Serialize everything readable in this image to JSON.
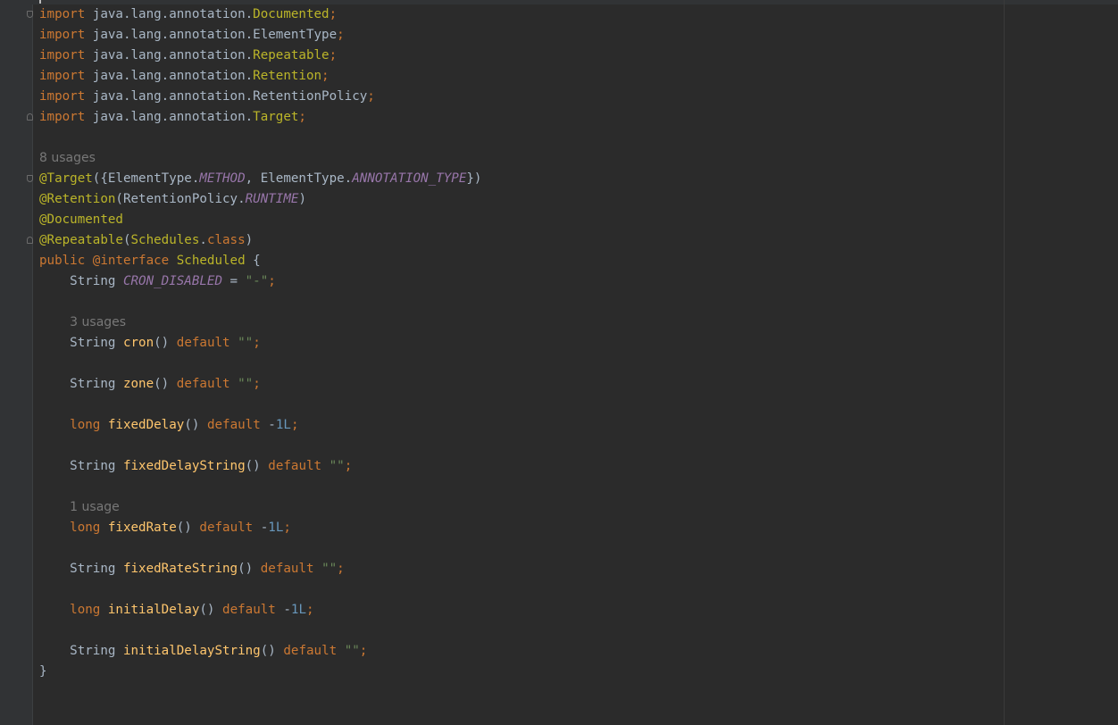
{
  "code": {
    "imports": [
      {
        "kw": "import",
        "pkg": "java.lang.annotation.",
        "cls": "Documented",
        "semi": ";"
      },
      {
        "kw": "import",
        "pkg": "java.lang.annotation.",
        "cls": "ElementType",
        "semi": ";"
      },
      {
        "kw": "import",
        "pkg": "java.lang.annotation.",
        "cls": "Repeatable",
        "semi": ";"
      },
      {
        "kw": "import",
        "pkg": "java.lang.annotation.",
        "cls": "Retention",
        "semi": ";"
      },
      {
        "kw": "import",
        "pkg": "java.lang.annotation.",
        "cls": "RetentionPolicy",
        "semi": ";"
      },
      {
        "kw": "import",
        "pkg": "java.lang.annotation.",
        "cls": "Target",
        "semi": ";"
      }
    ],
    "usages_8": "8 usages",
    "target": {
      "ann": "@Target",
      "p1": "({ElementType.",
      "c1": "METHOD",
      "p2": ", ElementType.",
      "c2": "ANNOTATION_TYPE",
      "p3": "})"
    },
    "retention": {
      "ann": "@Retention",
      "p1": "(RetentionPolicy.",
      "c1": "RUNTIME",
      "p2": ")"
    },
    "documented": "@Documented",
    "repeatable": {
      "ann": "@Repeatable",
      "p1": "(",
      "cls": "Schedules",
      "dot": ".",
      "kw": "class",
      "p2": ")"
    },
    "decl": {
      "kw": "public",
      "sp": " ",
      "ann": "@interface",
      "name": " Scheduled",
      "brace": " {"
    },
    "const_line": {
      "type": "String ",
      "name": "CRON_DISABLED",
      "eq": " = ",
      "val": "\"-\"",
      "semi": ";"
    },
    "usages_3": "3 usages",
    "usages_1": "1 usage",
    "default_kw": "default",
    "members": {
      "cron": {
        "type": "String ",
        "name": "cron",
        "parens": "()",
        "val": "\"\"",
        "semi": ";"
      },
      "zone": {
        "type": "String ",
        "name": "zone",
        "parens": "()",
        "val": "\"\"",
        "semi": ";"
      },
      "fixedDelay": {
        "type": "long",
        "name": "fixedDelay",
        "parens": "()",
        "minus": " -",
        "val": "1L",
        "semi": ";"
      },
      "fixedDelayString": {
        "type": "String ",
        "name": "fixedDelayString",
        "parens": "()",
        "val": "\"\"",
        "semi": ";"
      },
      "fixedRate": {
        "type": "long",
        "name": "fixedRate",
        "parens": "()",
        "minus": " -",
        "val": "1L",
        "semi": ";"
      },
      "fixedRateString": {
        "type": "String ",
        "name": "fixedRateString",
        "parens": "()",
        "val": "\"\"",
        "semi": ";"
      },
      "initialDelay": {
        "type": "long",
        "name": "initialDelay",
        "parens": "()",
        "minus": " -",
        "val": "1L",
        "semi": ";"
      },
      "initialDelayString": {
        "type": "String ",
        "name": "initialDelayString",
        "parens": "()",
        "val": "\"\"",
        "semi": ";"
      }
    },
    "closing_brace": "}"
  },
  "colors": {
    "background": "#2b2b2b",
    "gutter": "#313335",
    "keyword": "#cc7832",
    "annotation": "#bbb529",
    "method": "#ffc66d",
    "constant": "#9876aa",
    "string": "#6a8759",
    "number": "#6897bb",
    "plain": "#a9b7c6",
    "hint": "#787878"
  }
}
